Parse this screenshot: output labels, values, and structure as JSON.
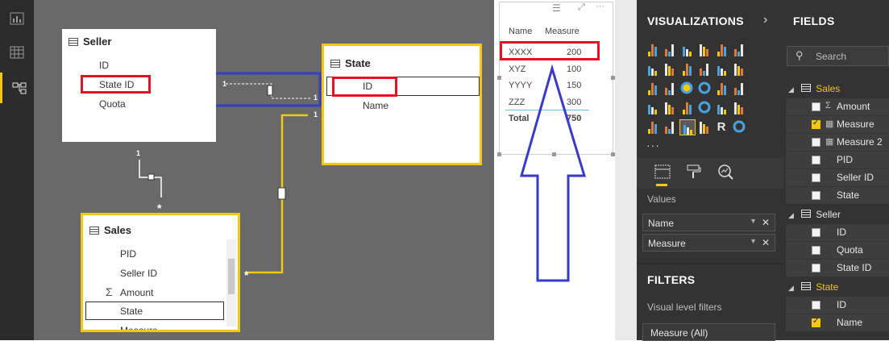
{
  "rail": {
    "icons": [
      "report-view-icon",
      "data-view-icon",
      "relationships-view-icon"
    ]
  },
  "model": {
    "seller": {
      "title": "Seller",
      "fields": [
        "ID",
        "State ID",
        "Quota"
      ]
    },
    "state": {
      "title": "State",
      "fields": [
        "ID",
        "Name"
      ]
    },
    "sales": {
      "title": "Sales",
      "fields": [
        "PID",
        "Seller ID",
        "Amount",
        "State",
        "Measure"
      ]
    },
    "rel_labels": {
      "one": "1",
      "many": "*"
    }
  },
  "visual": {
    "columns": [
      "Name",
      "Measure"
    ],
    "rows": [
      [
        "XXXX",
        "200"
      ],
      [
        "XYZ",
        "100"
      ],
      [
        "YYYY",
        "150"
      ],
      [
        "ZZZ",
        "300"
      ]
    ],
    "total": [
      "Total",
      "750"
    ],
    "menu": "···"
  },
  "viz_pane": {
    "title": "VISUALIZATIONS",
    "more": "···",
    "values_label": "Values",
    "wells": [
      "Name",
      "Measure"
    ],
    "filters_title": "FILTERS",
    "filters_label": "Visual level filters",
    "filter_item": "Measure (All)"
  },
  "fields_pane": {
    "title": "FIELDS",
    "search_placeholder": "Search",
    "groups": [
      {
        "name": "Sales",
        "color": "#f2c811",
        "items": [
          {
            "label": "Amount",
            "checked": false,
            "icon": "Σ"
          },
          {
            "label": "Measure",
            "checked": true,
            "icon": "▦"
          },
          {
            "label": "Measure 2",
            "checked": false,
            "icon": "▦"
          },
          {
            "label": "PID",
            "checked": false,
            "icon": ""
          },
          {
            "label": "Seller ID",
            "checked": false,
            "icon": ""
          },
          {
            "label": "State",
            "checked": false,
            "icon": ""
          }
        ]
      },
      {
        "name": "Seller",
        "color": "#e8e8e8",
        "items": [
          {
            "label": "ID",
            "checked": false,
            "icon": ""
          },
          {
            "label": "Quota",
            "checked": false,
            "icon": ""
          },
          {
            "label": "State ID",
            "checked": false,
            "icon": ""
          }
        ]
      },
      {
        "name": "State",
        "color": "#f2c811",
        "items": [
          {
            "label": "ID",
            "checked": false,
            "icon": ""
          },
          {
            "label": "Name",
            "checked": true,
            "icon": ""
          }
        ]
      }
    ]
  },
  "colors": {
    "highlight": "#e81123",
    "selection": "#f2c811",
    "relationship_box": "#3a3ac8",
    "arrow": "#3a3ac8"
  }
}
